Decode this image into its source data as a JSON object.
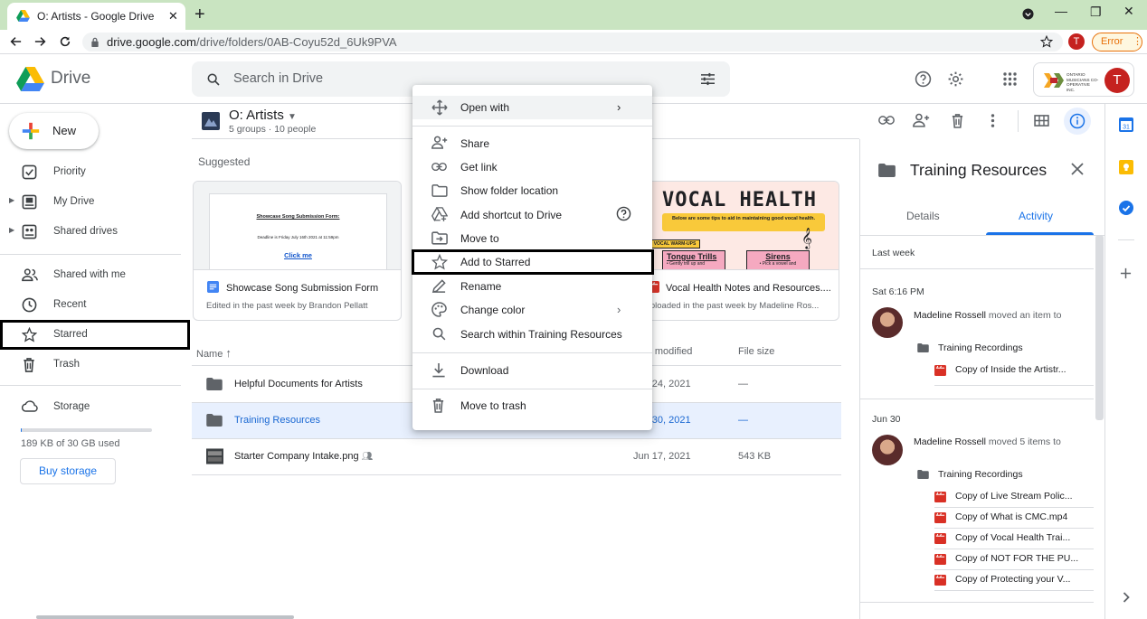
{
  "browser": {
    "tab_title": "O: Artists - Google Drive",
    "tab_close": "✕",
    "new_tab": "+",
    "url_host": "drive.google.com",
    "url_path": "/drive/folders/0AB-Coyu52d_6Uk9PVA",
    "profile_initial": "T",
    "error_label": "Error",
    "window_minimize": "—",
    "window_restore": "❐",
    "window_close": "✕"
  },
  "header": {
    "app_name": "Drive",
    "search_placeholder": "Search in Drive",
    "org_logo_text": "ONTARIO MUSICIANS CO-OPERATIVE INC.",
    "avatar_initial": "T"
  },
  "sidebar": {
    "new_label": "New",
    "items": [
      {
        "label": "Priority"
      },
      {
        "label": "My Drive"
      },
      {
        "label": "Shared drives"
      },
      {
        "label": "Shared with me"
      },
      {
        "label": "Recent"
      },
      {
        "label": "Starred"
      },
      {
        "label": "Trash"
      },
      {
        "label": "Storage"
      }
    ],
    "storage_used_fraction": 0.006,
    "storage_text": "189 KB of 30 GB used",
    "buy_storage": "Buy storage"
  },
  "main": {
    "folder_title": "O: Artists",
    "folder_subtitle": "5 groups · 10 people",
    "suggested_label": "Suggested",
    "cards": [
      {
        "name": "Showcase Song Submission Form",
        "meta": "Edited in the past week by Brandon Pellatt",
        "thumb_heading": "Showcase Song Submission Form:",
        "thumb_line": "Deadline is Friday July 16th 2021 at 11:59pm",
        "thumb_link": "Click me"
      },
      {
        "name": "Vocal Health Notes and Resources....",
        "meta": "Uploaded in the past week by Madeline Ros...",
        "thumb_heading": "VOCAL HEALTH",
        "thumb_sub": "Below are some tips to aid in maintaining good vocal health.",
        "thumb_tag": "VOCAL WARM-UPS",
        "thumb_item1": "Tongue Trills",
        "thumb_item1_sub": "• Gently trill up and",
        "thumb_item2": "Sirens",
        "thumb_item2_sub": "• Pick a vowel and"
      }
    ],
    "columns": {
      "name": "Name",
      "modified": "Last modified",
      "size": "File size"
    },
    "rows": [
      {
        "name": "Helpful Documents for Artists",
        "modified": "Jun 24, 2021",
        "size": "—"
      },
      {
        "name": "Training Resources",
        "modified": "Jun 30, 2021",
        "size": "—"
      },
      {
        "name": "Starter Company Intake.png",
        "modified": "Jun 17, 2021",
        "size": "543 KB"
      }
    ]
  },
  "context_menu": {
    "items": [
      {
        "label": "Open with",
        "arrow": "›"
      },
      {
        "label": "Share"
      },
      {
        "label": "Get link"
      },
      {
        "label": "Show folder location"
      },
      {
        "label": "Add shortcut to Drive"
      },
      {
        "label": "Move to"
      },
      {
        "label": "Add to Starred"
      },
      {
        "label": "Rename"
      },
      {
        "label": "Change color",
        "arrow": "›"
      },
      {
        "label": "Search within Training Resources"
      },
      {
        "label": "Download"
      },
      {
        "label": "Move to trash"
      }
    ]
  },
  "details_panel": {
    "title": "Training Resources",
    "tabs": [
      "Details",
      "Activity"
    ],
    "active_tab": "Activity",
    "groups": [
      {
        "range": "Last week"
      },
      {
        "range": ""
      }
    ],
    "events": [
      {
        "date": "Sat 6:16 PM",
        "user": "Madeline Rossell",
        "action": "moved an item to",
        "folder": "Training Recordings",
        "files": [
          "Copy of Inside the Artistr..."
        ]
      },
      {
        "date": "Jun 30",
        "user": "Madeline Rossell",
        "action": "moved 5 items to",
        "folder": "Training Recordings",
        "files": [
          "Copy of Live Stream Polic...",
          "Copy of What is CMC.mp4",
          "Copy of Vocal Health Trai...",
          "Copy of NOT FOR THE PU...",
          "Copy of Protecting your V..."
        ]
      }
    ]
  },
  "colors": {
    "accent": "#1a73e8",
    "selected_row": "#e8f0fe",
    "tabstrip": "#c9e4c1",
    "video_red": "#d93025",
    "folder_gray": "#5f6368"
  }
}
